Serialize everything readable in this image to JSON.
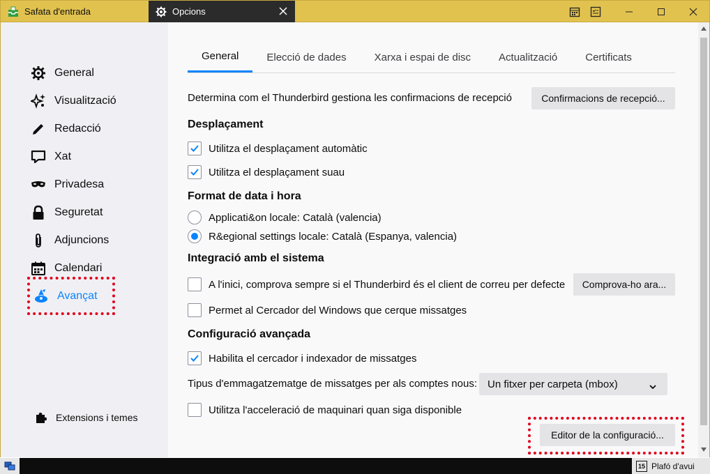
{
  "titlebar": {
    "inbox_tab": "Safata d'entrada",
    "active_tab": "Opcions"
  },
  "sidebar": {
    "items": [
      {
        "label": "General",
        "icon": "gear-icon"
      },
      {
        "label": "Visualització",
        "icon": "sparkle-icon"
      },
      {
        "label": "Redacció",
        "icon": "pen-icon"
      },
      {
        "label": "Xat",
        "icon": "chat-icon"
      },
      {
        "label": "Privadesa",
        "icon": "mask-icon"
      },
      {
        "label": "Seguretat",
        "icon": "lock-icon"
      },
      {
        "label": "Adjuncions",
        "icon": "paperclip-icon"
      },
      {
        "label": "Calendari",
        "icon": "calendar-icon"
      },
      {
        "label": "Avançat",
        "icon": "wizard-icon"
      }
    ],
    "extensions_label": "Extensions i temes"
  },
  "tabs": [
    "General",
    "Elecció de dades",
    "Xarxa i espai de disc",
    "Actualització",
    "Certificats"
  ],
  "receipts": {
    "description": "Determina com el Thunderbird gestiona les confirmacions de recepció",
    "button": "Confirmacions de recepció..."
  },
  "scrolling": {
    "heading": "Desplaçament",
    "auto": "Utilitza el desplaçament automàtic",
    "smooth": "Utilitza el desplaçament suau"
  },
  "datetime": {
    "heading": "Format de data i hora",
    "app_locale": "Applicati&on locale: Català (valencia)",
    "regional_locale": "R&egional settings locale: Català (Espanya, valencia)"
  },
  "integration": {
    "heading": "Integració amb el sistema",
    "default_client": "A l'inici, comprova sempre si el Thunderbird és el client de correu per defecte",
    "check_button": "Comprova-ho ara...",
    "search": "Permet al Cercador del Windows que cerque missatges"
  },
  "advanced": {
    "heading": "Configuració avançada",
    "indexer": "Habilita el cercador i indexador de missatges",
    "storage_label": "Tipus d'emmagatzematge de missatges per als comptes nous:",
    "storage_value": "Un fitxer per carpeta (mbox)",
    "hw_accel": "Utilitza l'acceleració de maquinari quan siga disponible",
    "config_editor": "Editor de la configuració..."
  },
  "taskbar": {
    "right_label": "Plafó d'avui",
    "calendar_day": "15"
  },
  "colors": {
    "titlebar": "#e1c24f",
    "accent": "#0a84ff",
    "highlight_box": "#e0001b"
  }
}
